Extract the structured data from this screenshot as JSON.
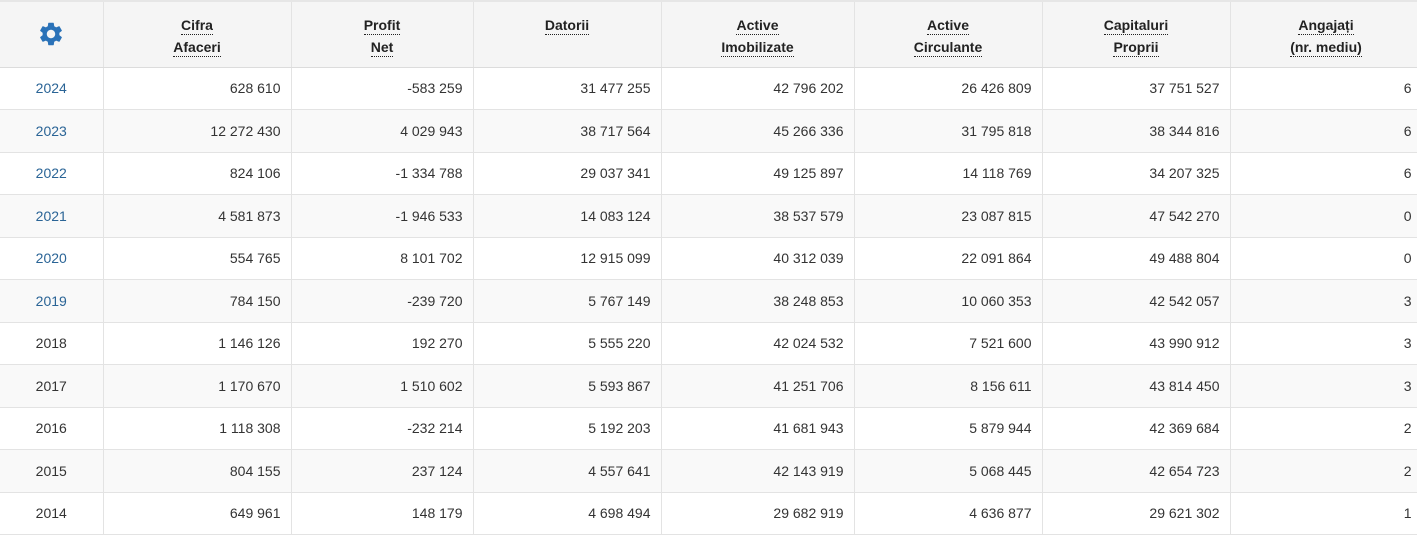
{
  "colors": {
    "accent": "#2a72b8",
    "link": "#2a6496",
    "header_bg": "#f5f5f5",
    "stripe_bg": "#f9f9f9"
  },
  "settings_icon": "gear-icon",
  "headers": [
    [
      "Cifra",
      "Afaceri"
    ],
    [
      "Profit",
      "Net"
    ],
    [
      "Datorii"
    ],
    [
      "Active",
      "Imobilizate"
    ],
    [
      "Active",
      "Circulante"
    ],
    [
      "Capitaluri",
      "Proprii"
    ],
    [
      "Angajați",
      "(nr. mediu)"
    ]
  ],
  "rows": [
    {
      "year": "2024",
      "link": true,
      "values": [
        "628 610",
        "-583 259",
        "31 477 255",
        "42 796 202",
        "26 426 809",
        "37 751 527",
        "6"
      ]
    },
    {
      "year": "2023",
      "link": true,
      "values": [
        "12 272 430",
        "4 029 943",
        "38 717 564",
        "45 266 336",
        "31 795 818",
        "38 344 816",
        "6"
      ]
    },
    {
      "year": "2022",
      "link": true,
      "values": [
        "824 106",
        "-1 334 788",
        "29 037 341",
        "49 125 897",
        "14 118 769",
        "34 207 325",
        "6"
      ]
    },
    {
      "year": "2021",
      "link": true,
      "values": [
        "4 581 873",
        "-1 946 533",
        "14 083 124",
        "38 537 579",
        "23 087 815",
        "47 542 270",
        "0"
      ]
    },
    {
      "year": "2020",
      "link": true,
      "values": [
        "554 765",
        "8 101 702",
        "12 915 099",
        "40 312 039",
        "22 091 864",
        "49 488 804",
        "0"
      ]
    },
    {
      "year": "2019",
      "link": true,
      "values": [
        "784 150",
        "-239 720",
        "5 767 149",
        "38 248 853",
        "10 060 353",
        "42 542 057",
        "3"
      ]
    },
    {
      "year": "2018",
      "link": false,
      "values": [
        "1 146 126",
        "192 270",
        "5 555 220",
        "42 024 532",
        "7 521 600",
        "43 990 912",
        "3"
      ]
    },
    {
      "year": "2017",
      "link": false,
      "values": [
        "1 170 670",
        "1 510 602",
        "5 593 867",
        "41 251 706",
        "8 156 611",
        "43 814 450",
        "3"
      ]
    },
    {
      "year": "2016",
      "link": false,
      "values": [
        "1 118 308",
        "-232 214",
        "5 192 203",
        "41 681 943",
        "5 879 944",
        "42 369 684",
        "2"
      ]
    },
    {
      "year": "2015",
      "link": false,
      "values": [
        "804 155",
        "237 124",
        "4 557 641",
        "42 143 919",
        "5 068 445",
        "42 654 723",
        "2"
      ]
    },
    {
      "year": "2014",
      "link": false,
      "values": [
        "649 961",
        "148 179",
        "4 698 494",
        "29 682 919",
        "4 636 877",
        "29 621 302",
        "1"
      ]
    }
  ]
}
